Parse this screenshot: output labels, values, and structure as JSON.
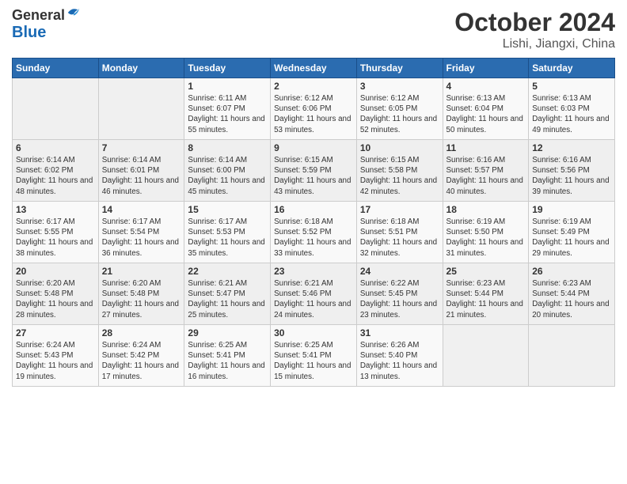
{
  "header": {
    "logo_line1": "General",
    "logo_line2": "Blue",
    "title": "October 2024",
    "subtitle": "Lishi, Jiangxi, China"
  },
  "weekdays": [
    "Sunday",
    "Monday",
    "Tuesday",
    "Wednesday",
    "Thursday",
    "Friday",
    "Saturday"
  ],
  "weeks": [
    [
      {
        "day": "",
        "info": ""
      },
      {
        "day": "",
        "info": ""
      },
      {
        "day": "1",
        "info": "Sunrise: 6:11 AM\nSunset: 6:07 PM\nDaylight: 11 hours and 55 minutes."
      },
      {
        "day": "2",
        "info": "Sunrise: 6:12 AM\nSunset: 6:06 PM\nDaylight: 11 hours and 53 minutes."
      },
      {
        "day": "3",
        "info": "Sunrise: 6:12 AM\nSunset: 6:05 PM\nDaylight: 11 hours and 52 minutes."
      },
      {
        "day": "4",
        "info": "Sunrise: 6:13 AM\nSunset: 6:04 PM\nDaylight: 11 hours and 50 minutes."
      },
      {
        "day": "5",
        "info": "Sunrise: 6:13 AM\nSunset: 6:03 PM\nDaylight: 11 hours and 49 minutes."
      }
    ],
    [
      {
        "day": "6",
        "info": "Sunrise: 6:14 AM\nSunset: 6:02 PM\nDaylight: 11 hours and 48 minutes."
      },
      {
        "day": "7",
        "info": "Sunrise: 6:14 AM\nSunset: 6:01 PM\nDaylight: 11 hours and 46 minutes."
      },
      {
        "day": "8",
        "info": "Sunrise: 6:14 AM\nSunset: 6:00 PM\nDaylight: 11 hours and 45 minutes."
      },
      {
        "day": "9",
        "info": "Sunrise: 6:15 AM\nSunset: 5:59 PM\nDaylight: 11 hours and 43 minutes."
      },
      {
        "day": "10",
        "info": "Sunrise: 6:15 AM\nSunset: 5:58 PM\nDaylight: 11 hours and 42 minutes."
      },
      {
        "day": "11",
        "info": "Sunrise: 6:16 AM\nSunset: 5:57 PM\nDaylight: 11 hours and 40 minutes."
      },
      {
        "day": "12",
        "info": "Sunrise: 6:16 AM\nSunset: 5:56 PM\nDaylight: 11 hours and 39 minutes."
      }
    ],
    [
      {
        "day": "13",
        "info": "Sunrise: 6:17 AM\nSunset: 5:55 PM\nDaylight: 11 hours and 38 minutes."
      },
      {
        "day": "14",
        "info": "Sunrise: 6:17 AM\nSunset: 5:54 PM\nDaylight: 11 hours and 36 minutes."
      },
      {
        "day": "15",
        "info": "Sunrise: 6:17 AM\nSunset: 5:53 PM\nDaylight: 11 hours and 35 minutes."
      },
      {
        "day": "16",
        "info": "Sunrise: 6:18 AM\nSunset: 5:52 PM\nDaylight: 11 hours and 33 minutes."
      },
      {
        "day": "17",
        "info": "Sunrise: 6:18 AM\nSunset: 5:51 PM\nDaylight: 11 hours and 32 minutes."
      },
      {
        "day": "18",
        "info": "Sunrise: 6:19 AM\nSunset: 5:50 PM\nDaylight: 11 hours and 31 minutes."
      },
      {
        "day": "19",
        "info": "Sunrise: 6:19 AM\nSunset: 5:49 PM\nDaylight: 11 hours and 29 minutes."
      }
    ],
    [
      {
        "day": "20",
        "info": "Sunrise: 6:20 AM\nSunset: 5:48 PM\nDaylight: 11 hours and 28 minutes."
      },
      {
        "day": "21",
        "info": "Sunrise: 6:20 AM\nSunset: 5:48 PM\nDaylight: 11 hours and 27 minutes."
      },
      {
        "day": "22",
        "info": "Sunrise: 6:21 AM\nSunset: 5:47 PM\nDaylight: 11 hours and 25 minutes."
      },
      {
        "day": "23",
        "info": "Sunrise: 6:21 AM\nSunset: 5:46 PM\nDaylight: 11 hours and 24 minutes."
      },
      {
        "day": "24",
        "info": "Sunrise: 6:22 AM\nSunset: 5:45 PM\nDaylight: 11 hours and 23 minutes."
      },
      {
        "day": "25",
        "info": "Sunrise: 6:23 AM\nSunset: 5:44 PM\nDaylight: 11 hours and 21 minutes."
      },
      {
        "day": "26",
        "info": "Sunrise: 6:23 AM\nSunset: 5:44 PM\nDaylight: 11 hours and 20 minutes."
      }
    ],
    [
      {
        "day": "27",
        "info": "Sunrise: 6:24 AM\nSunset: 5:43 PM\nDaylight: 11 hours and 19 minutes."
      },
      {
        "day": "28",
        "info": "Sunrise: 6:24 AM\nSunset: 5:42 PM\nDaylight: 11 hours and 17 minutes."
      },
      {
        "day": "29",
        "info": "Sunrise: 6:25 AM\nSunset: 5:41 PM\nDaylight: 11 hours and 16 minutes."
      },
      {
        "day": "30",
        "info": "Sunrise: 6:25 AM\nSunset: 5:41 PM\nDaylight: 11 hours and 15 minutes."
      },
      {
        "day": "31",
        "info": "Sunrise: 6:26 AM\nSunset: 5:40 PM\nDaylight: 11 hours and 13 minutes."
      },
      {
        "day": "",
        "info": ""
      },
      {
        "day": "",
        "info": ""
      }
    ]
  ]
}
